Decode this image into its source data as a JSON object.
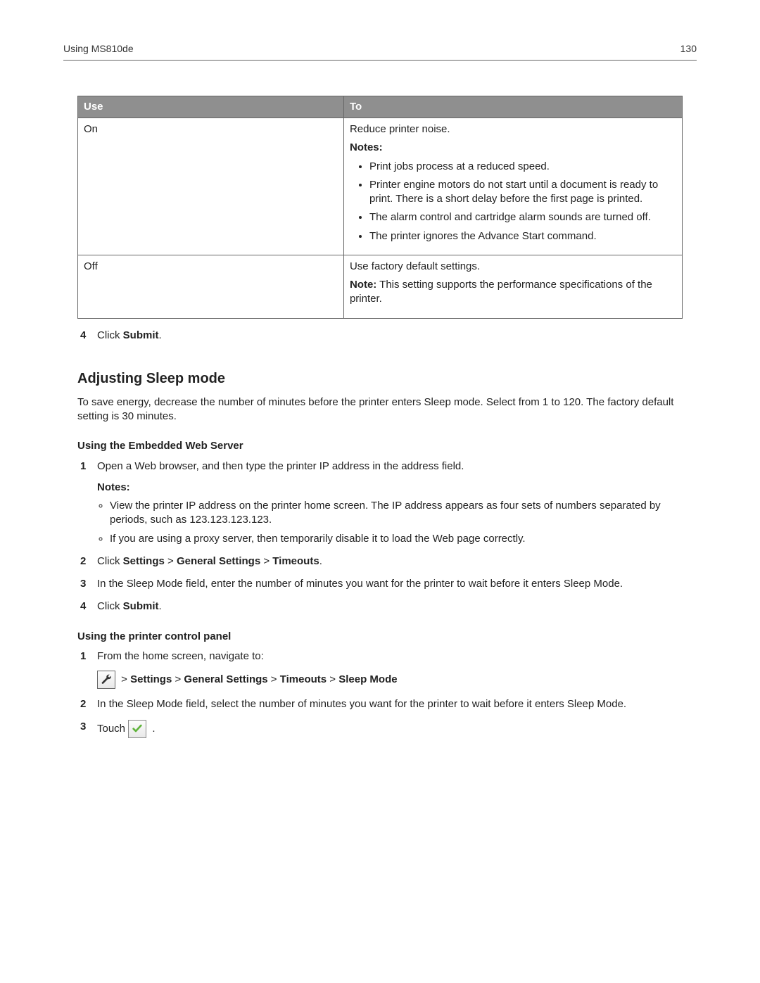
{
  "header": {
    "section": "Using MS810de",
    "pageNumber": "130"
  },
  "table": {
    "headers": {
      "use": "Use",
      "to": "To"
    },
    "rows": [
      {
        "use": "On",
        "to": {
          "line1": "Reduce printer noise.",
          "notesLabel": "Notes:",
          "notes": [
            "Print jobs process at a reduced speed.",
            "Printer engine motors do not start until a document is ready to print. There is a short delay before the first page is printed.",
            "The alarm control and cartridge alarm sounds are turned off.",
            "The printer ignores the Advance Start command."
          ]
        }
      },
      {
        "use": "Off",
        "to": {
          "line1": "Use factory default settings.",
          "noteBold": "Note:",
          "noteText": " This setting supports the performance specifications of the printer."
        }
      }
    ]
  },
  "step4a": {
    "num": "4",
    "prefix": "Click ",
    "bold": "Submit",
    "suffix": "."
  },
  "sleep": {
    "title": "Adjusting Sleep mode",
    "intro": "To save energy, decrease the number of minutes before the printer enters Sleep mode. Select from 1 to 120. The factory default setting is 30 minutes.",
    "web": {
      "title": "Using the Embedded Web Server",
      "steps": {
        "s1": {
          "num": "1",
          "text": "Open a Web browser, and then type the printer IP address in the address field."
        },
        "notesLabel": "Notes:",
        "notes": [
          "View the printer IP address on the printer home screen. The IP address appears as four sets of numbers separated by periods, such as 123.123.123.123.",
          "If you are using a proxy server, then temporarily disable it to load the Web page correctly."
        ],
        "s2": {
          "num": "2",
          "prefix": "Click ",
          "b1": "Settings",
          "gt1": " > ",
          "b2": "General Settings",
          "gt2": " > ",
          "b3": "Timeouts",
          "suffix": "."
        },
        "s3": {
          "num": "3",
          "text": "In the Sleep Mode field, enter the number of minutes you want for the printer to wait before it enters Sleep Mode."
        },
        "s4": {
          "num": "4",
          "prefix": "Click ",
          "bold": "Submit",
          "suffix": "."
        }
      }
    },
    "panel": {
      "title": "Using the printer control panel",
      "steps": {
        "s1": {
          "num": "1",
          "text": "From the home screen, navigate to:"
        },
        "nav": {
          "gt0": " > ",
          "b1": "Settings",
          "gt1": " > ",
          "b2": "General Settings",
          "gt2": " > ",
          "b3": "Timeouts",
          "gt3": " > ",
          "b4": "Sleep Mode"
        },
        "s2": {
          "num": "2",
          "text": "In the Sleep Mode field, select the number of minutes you want for the printer to wait before it enters Sleep Mode."
        },
        "s3": {
          "num": "3",
          "prefix": "Touch ",
          "suffix": " ."
        }
      }
    }
  }
}
